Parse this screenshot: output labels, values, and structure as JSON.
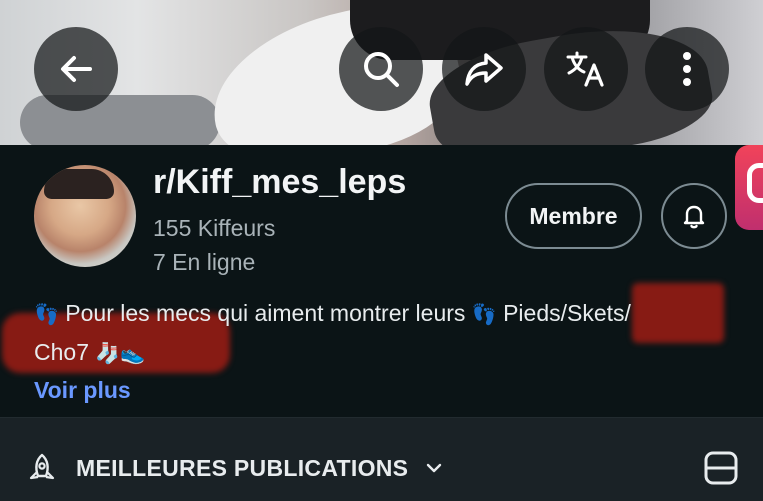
{
  "community": {
    "name": "r/Kiff_mes_leps",
    "members": "155 Kiffeurs",
    "online": "7 En ligne",
    "description_part1": "Pour les mecs qui aiment montrer leurs",
    "description_part2": "Pieds/",
    "description_part3": "Skets/",
    "description_part4": "Cho7",
    "foot_emoji": "👣",
    "socks_emoji": "🧦",
    "shoe_emoji": "👟",
    "see_more": "Voir plus"
  },
  "actions": {
    "join_label": "Membre",
    "back": "back-arrow-icon",
    "search": "search-icon",
    "share": "share-icon",
    "translate": "translate-icon",
    "more": "more-vertical-icon",
    "bell": "bell-icon"
  },
  "feed": {
    "sort_label": "MEILLEURES PUBLICATIONS",
    "sort_icon": "rocket-icon",
    "view_icon": "card-view-icon"
  },
  "colors": {
    "background": "#0b1416",
    "link": "#6a98ff",
    "secondary_text": "#a9b3b8",
    "redaction": "#b21e14"
  }
}
